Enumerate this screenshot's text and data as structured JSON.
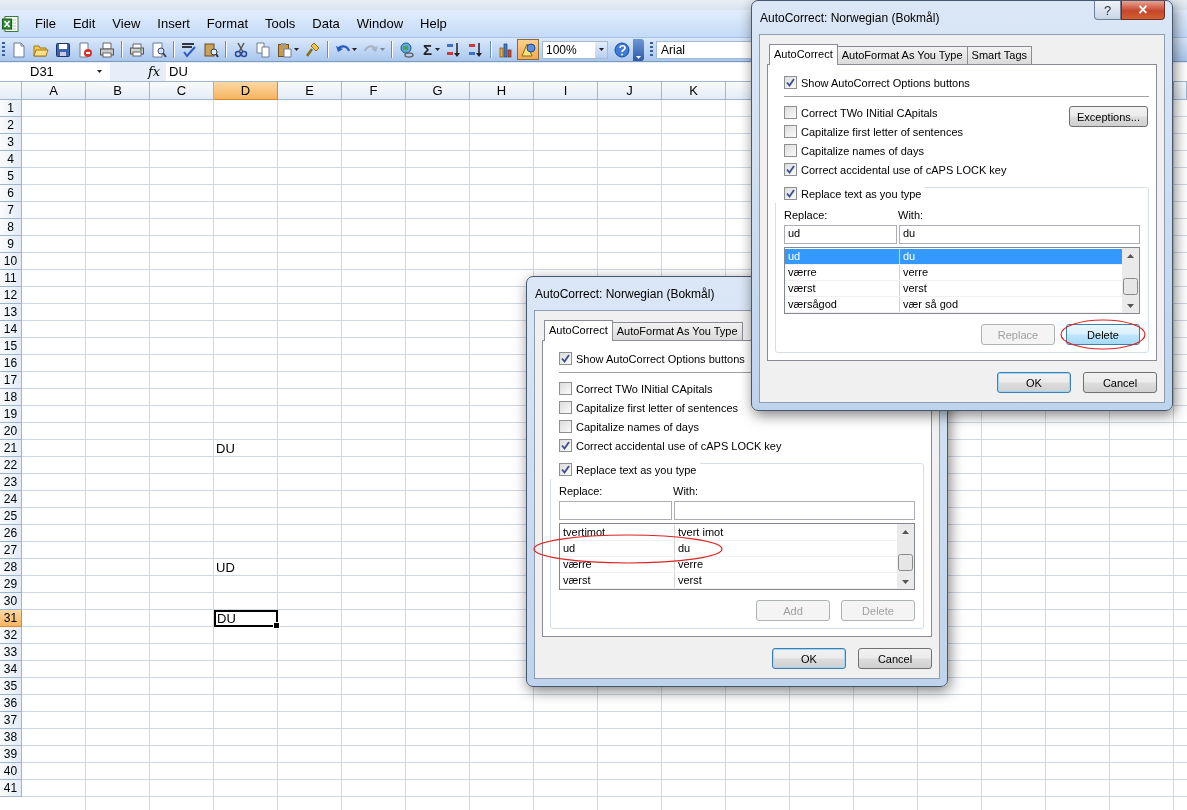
{
  "menu_bar": {
    "items": [
      "File",
      "Edit",
      "View",
      "Insert",
      "Format",
      "Tools",
      "Data",
      "Window",
      "Help"
    ]
  },
  "toolbar": {
    "items": [
      {
        "kind": "new",
        "pressed": false,
        "disabled": false
      },
      {
        "kind": "open",
        "pressed": false,
        "disabled": false
      },
      {
        "kind": "save",
        "pressed": false,
        "disabled": false
      },
      {
        "kind": "permission",
        "pressed": false,
        "disabled": false
      },
      {
        "kind": "email",
        "pressed": false,
        "disabled": false
      },
      {
        "kind": "separator"
      },
      {
        "kind": "print",
        "pressed": false,
        "disabled": false
      },
      {
        "kind": "preview",
        "pressed": false,
        "disabled": false
      },
      {
        "kind": "separator"
      },
      {
        "kind": "spelling",
        "pressed": false,
        "disabled": false
      },
      {
        "kind": "research",
        "pressed": false,
        "disabled": false
      },
      {
        "kind": "separator"
      },
      {
        "kind": "cut",
        "pressed": false,
        "disabled": false
      },
      {
        "kind": "copy",
        "pressed": false,
        "disabled": false
      },
      {
        "kind": "paste",
        "pressed": false,
        "disabled": false,
        "dropdown": true
      },
      {
        "kind": "painter",
        "pressed": false,
        "disabled": false
      },
      {
        "kind": "separator"
      },
      {
        "kind": "undo",
        "pressed": false,
        "disabled": false,
        "dropdown": true
      },
      {
        "kind": "redo",
        "pressed": false,
        "disabled": true,
        "dropdown": true
      },
      {
        "kind": "separator"
      },
      {
        "kind": "hyperlink",
        "pressed": false,
        "disabled": false
      },
      {
        "kind": "autosum",
        "label": "Σ",
        "pressed": false,
        "disabled": false,
        "dropdown": true
      },
      {
        "kind": "sort_ascending",
        "pressed": false,
        "disabled": false
      },
      {
        "kind": "sort_descending",
        "pressed": false,
        "disabled": false
      },
      {
        "kind": "separator"
      },
      {
        "kind": "chart",
        "pressed": false,
        "disabled": false
      },
      {
        "kind": "drawing",
        "pressed": true,
        "disabled": false
      },
      {
        "kind": "zoom",
        "value": "100%"
      },
      {
        "kind": "help",
        "pressed": false,
        "disabled": false
      },
      {
        "kind": "overflow"
      }
    ],
    "font": "Arial"
  },
  "formula_bar": {
    "name_box": "D31",
    "fx": "fx",
    "formula": "DU"
  },
  "sheet": {
    "columns": [
      {
        "label": "A",
        "selected": false
      },
      {
        "label": "B",
        "selected": false
      },
      {
        "label": "C",
        "selected": false
      },
      {
        "label": "D",
        "selected": true
      },
      {
        "label": "E",
        "selected": false
      },
      {
        "label": "F",
        "selected": false
      },
      {
        "label": "G",
        "selected": false
      },
      {
        "label": "H",
        "selected": false
      },
      {
        "label": "I",
        "selected": false
      },
      {
        "label": "J",
        "selected": false
      },
      {
        "label": "K",
        "selected": false
      }
    ],
    "rows": [
      {
        "label": "1",
        "selected": false
      },
      {
        "label": "2",
        "selected": false
      },
      {
        "label": "3",
        "selected": false
      },
      {
        "label": "4",
        "selected": false
      },
      {
        "label": "5",
        "selected": false
      },
      {
        "label": "6",
        "selected": false
      },
      {
        "label": "7",
        "selected": false
      },
      {
        "label": "8",
        "selected": false
      },
      {
        "label": "9",
        "selected": false
      },
      {
        "label": "10",
        "selected": false
      },
      {
        "label": "11",
        "selected": false
      },
      {
        "label": "12",
        "selected": false
      },
      {
        "label": "13",
        "selected": false
      },
      {
        "label": "14",
        "selected": false
      },
      {
        "label": "15",
        "selected": false
      },
      {
        "label": "16",
        "selected": false
      },
      {
        "label": "17",
        "selected": false
      },
      {
        "label": "18",
        "selected": false
      },
      {
        "label": "19",
        "selected": false
      },
      {
        "label": "20",
        "selected": false
      },
      {
        "label": "21",
        "selected": false,
        "cells": {
          "D": {
            "text": "DU",
            "selected": false
          }
        }
      },
      {
        "label": "22",
        "selected": false
      },
      {
        "label": "23",
        "selected": false
      },
      {
        "label": "24",
        "selected": false
      },
      {
        "label": "25",
        "selected": false
      },
      {
        "label": "26",
        "selected": false
      },
      {
        "label": "27",
        "selected": false
      },
      {
        "label": "28",
        "selected": false,
        "cells": {
          "D": {
            "text": "UD",
            "selected": false
          }
        }
      },
      {
        "label": "29",
        "selected": false
      },
      {
        "label": "30",
        "selected": false
      },
      {
        "label": "31",
        "selected": true,
        "cells": {
          "D": {
            "text": "DU",
            "selected": true
          }
        }
      },
      {
        "label": "32",
        "selected": false
      },
      {
        "label": "33",
        "selected": false
      },
      {
        "label": "34",
        "selected": false
      },
      {
        "label": "35",
        "selected": false
      },
      {
        "label": "36",
        "selected": false
      },
      {
        "label": "37",
        "selected": false
      },
      {
        "label": "38",
        "selected": false
      },
      {
        "label": "39",
        "selected": false
      },
      {
        "label": "40",
        "selected": false
      },
      {
        "label": "41",
        "selected": false
      }
    ]
  },
  "dialogs": [
    {
      "title": "AutoCorrect: Norwegian (Bokmål)",
      "help_button": "?",
      "close_button": "×",
      "tabs": [
        {
          "label": "AutoCorrect",
          "selected": true
        },
        {
          "label": "AutoFormat As You Type",
          "selected": false
        },
        {
          "label": "Smart Tags",
          "selected": false
        }
      ],
      "top_option": {
        "label": "Show AutoCorrect Options buttons",
        "checked": true
      },
      "options": [
        {
          "label": "Correct TWo INitial CApitals",
          "checked": false
        },
        {
          "label": "Capitalize first letter of sentences",
          "checked": false
        },
        {
          "label": "Capitalize names of days",
          "checked": false
        },
        {
          "label": "Correct accidental use of cAPS LOCK key",
          "checked": true
        }
      ],
      "exceptions_button": "Exceptions...",
      "replace_group": {
        "label": "Replace text as you type",
        "checked": true,
        "replace_label": "Replace:",
        "with_label": "With:",
        "replace_value": "ud",
        "with_value": "du",
        "entries": [
          {
            "replace": "ud",
            "with": "du",
            "selected": true,
            "circled": false
          },
          {
            "replace": "værre",
            "with": "verre",
            "selected": false,
            "circled": false
          },
          {
            "replace": "værst",
            "with": "verst",
            "selected": false,
            "circled": false
          },
          {
            "replace": "værsågod",
            "with": "vær så god",
            "selected": false,
            "circled": false
          }
        ],
        "buttons": [
          {
            "label": "Replace",
            "disabled": true,
            "focused": false,
            "circled": false
          },
          {
            "label": "Delete",
            "disabled": false,
            "focused": true,
            "circled": true
          }
        ]
      },
      "buttons": [
        {
          "label": "OK",
          "default": true
        },
        {
          "label": "Cancel",
          "default": false
        }
      ]
    },
    {
      "title": "AutoCorrect: Norwegian (Bokmål)",
      "tabs": [
        {
          "label": "AutoCorrect",
          "selected": true
        },
        {
          "label": "AutoFormat As You Type",
          "selected": false
        }
      ],
      "top_option": {
        "label": "Show AutoCorrect Options buttons",
        "checked": true
      },
      "options": [
        {
          "label": "Correct TWo INitial CApitals",
          "checked": false
        },
        {
          "label": "Capitalize first letter of sentences",
          "checked": false
        },
        {
          "label": "Capitalize names of days",
          "checked": false
        },
        {
          "label": "Correct accidental use of cAPS LOCK key",
          "checked": true
        }
      ],
      "replace_group": {
        "label": "Replace text as you type",
        "checked": true,
        "replace_label": "Replace:",
        "with_label": "With:",
        "entries": [
          {
            "replace": "tvertimot",
            "with": "tvert imot",
            "selected": false,
            "circled": false
          },
          {
            "replace": "ud",
            "with": "du",
            "selected": false,
            "circled": true
          },
          {
            "replace": "værre",
            "with": "verre",
            "selected": false,
            "circled": false
          },
          {
            "replace": "værst",
            "with": "verst",
            "selected": false,
            "circled": false
          }
        ],
        "buttons": [
          {
            "label": "Add",
            "disabled": true,
            "focused": false,
            "circled": false
          },
          {
            "label": "Delete",
            "disabled": true,
            "focused": false,
            "circled": false
          }
        ]
      },
      "buttons": [
        {
          "label": "OK",
          "default": true
        },
        {
          "label": "Cancel",
          "default": false
        }
      ]
    }
  ]
}
